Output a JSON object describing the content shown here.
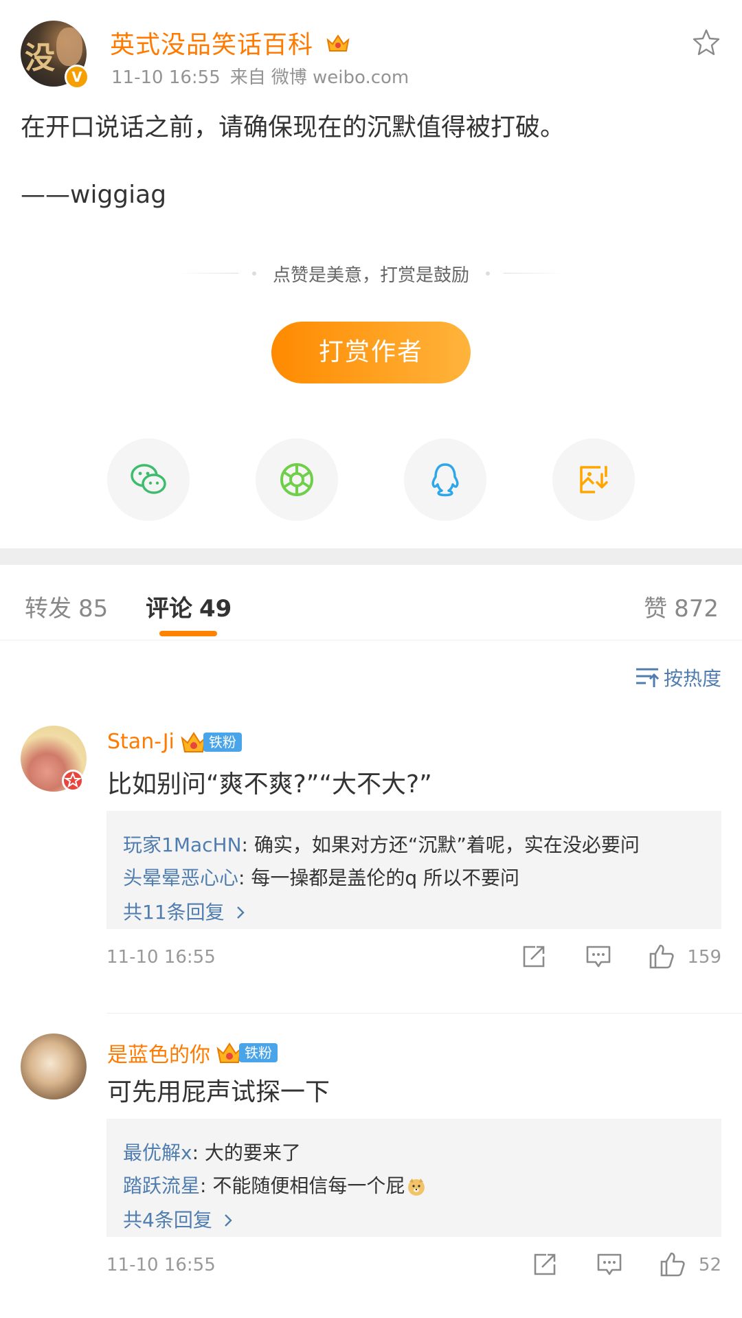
{
  "post": {
    "author": "英式没品笑话百科",
    "time": "11-10 16:55",
    "source_prefix": "来自",
    "source": "微博 weibo.com",
    "body": [
      "在开口说话之前，请确保现在的沉默值得被打破。",
      "——wiggiag"
    ]
  },
  "reward": {
    "tip": "点赞是美意，打赏是鼓励",
    "button_label": "打赏作者"
  },
  "share": {
    "items": [
      "wechat-icon",
      "moments-icon",
      "qq-icon",
      "save-image-icon"
    ]
  },
  "tabs": {
    "repost_label": "转发",
    "repost_count": "85",
    "comment_label": "评论",
    "comment_count": "49",
    "like_label": "赞",
    "like_count": "872"
  },
  "sort": {
    "label": "按热度"
  },
  "comments": [
    {
      "user": "Stan-Ji",
      "fan_tag": "铁粉",
      "text": "比如别问“爽不爽?”“大不大?”",
      "replies": [
        {
          "user": "玩家1MacHN",
          "text": ": 确实，如果对方还“沉默”着呢，实在没必要问"
        },
        {
          "user": "头晕晕恶心心",
          "text": ": 每一操都是盖伦的q  所以不要问"
        }
      ],
      "more_replies": "共11条回复",
      "time": "11-10 16:55",
      "likes": "159"
    },
    {
      "user": "是蓝色的你",
      "fan_tag": "铁粉",
      "text": "可先用屁声试探一下",
      "replies": [
        {
          "user": "最优解x",
          "text": ": 大的要来了"
        },
        {
          "user": "踏跃流星",
          "text": ": 不能随便相信每一个屁"
        }
      ],
      "more_replies": "共4条回复",
      "time": "11-10 16:55",
      "likes": "52"
    }
  ],
  "colors": {
    "accent": "#ff8200",
    "link": "#507daf",
    "name": "#ff7a00"
  }
}
